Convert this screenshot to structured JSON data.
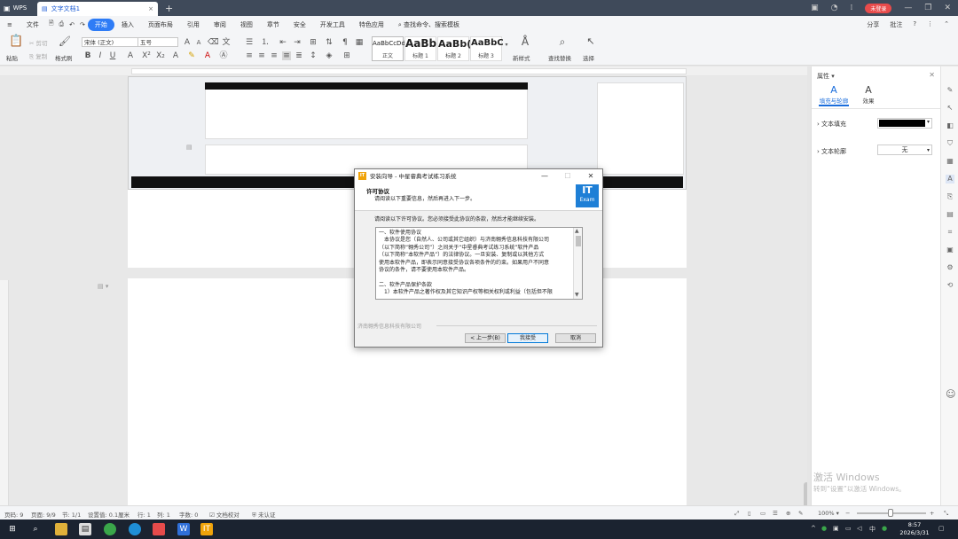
{
  "titlebar": {
    "wps_label": "WPS",
    "doc_tab": "文字文档1",
    "new_tab": "+",
    "login": "未登录"
  },
  "menu": {
    "items": [
      "文件",
      "开始",
      "插入",
      "页面布局",
      "引用",
      "审阅",
      "视图",
      "章节",
      "安全",
      "开发工具",
      "特色应用"
    ],
    "active": "开始",
    "search": "查找命令、搜索模板",
    "share": "分享",
    "comment": "批注"
  },
  "ribbon": {
    "paste": "粘贴",
    "cut": "剪切",
    "copy": "复制",
    "format_painter": "格式刷",
    "font_name": "宋体 (正文)",
    "font_size": "五号",
    "styles": [
      {
        "sample": "AaBbCcDd",
        "name": "正文"
      },
      {
        "sample": "AaBb",
        "name": "标题 1"
      },
      {
        "sample": "AaBb(",
        "name": "标题 2"
      },
      {
        "sample": "AaBbC",
        "name": "标题 3"
      }
    ],
    "new_style": "新样式",
    "find_replace": "查找替换",
    "select": "选择"
  },
  "dialog": {
    "title": "安装向导 - 中星睿典考试练习系统",
    "header_title": "许可协议",
    "header_sub": "请阅读以下重要信息，然后再进入下一步。",
    "logo_top": "IT",
    "logo_bottom": "Exam",
    "intro": "请阅读以下许可协议。您必须接受此协议的条款，然后才能继续安装。",
    "license_lines": [
      "一、软件使用协议",
      "　本协议是您（自然人、公司或其它组织）与济南翱秀信息科技有限公司",
      "（以下简称“翱秀公司”）之间关于“中星睿典考试练习系统”软件产品",
      "（以下简称“本软件产品”）的法律协议。一旦安装、复制或以其他方式",
      "使用本软件产品，即表示同意接受协议各项条件的约束。如果用户不同意",
      "协议的条件，请不要使用本软件产品。",
      "",
      "二、软件产品保护条款",
      "　1）本软件产品之著作权及其它知识产权等相关权利或利益（包括但不限"
    ],
    "company": "济南翱秀信息科技有限公司",
    "back": "< 上一步(B)",
    "accept": "我接受",
    "cancel": "取消"
  },
  "panel": {
    "title": "属性",
    "tab_fill": "填充与轮廓",
    "tab_effect": "效果",
    "text_fill": "文本填充",
    "text_outline": "文本轮廓",
    "outline_value": "无",
    "fill_color": "#000000"
  },
  "watermark": {
    "line1": "激活 Windows",
    "line2": "转到“设置”以激活 Windows。"
  },
  "status": {
    "page_num": "页码: 9",
    "pages": "页面: 9/9",
    "section": "节: 1/1",
    "setting": "设置值: 0.1厘米",
    "row": "行: 1",
    "col": "列: 1",
    "chars": "字数: 0",
    "spell": "文档校对",
    "cert": "未认证",
    "zoom": "100%"
  },
  "taskbar": {
    "time": "8:57",
    "date": "2026/3/31",
    "tray": "中"
  },
  "colors": {
    "accent": "#2e7cf6",
    "title_bg": "#3f4a5a",
    "taskbar_bg": "#1b2330"
  }
}
